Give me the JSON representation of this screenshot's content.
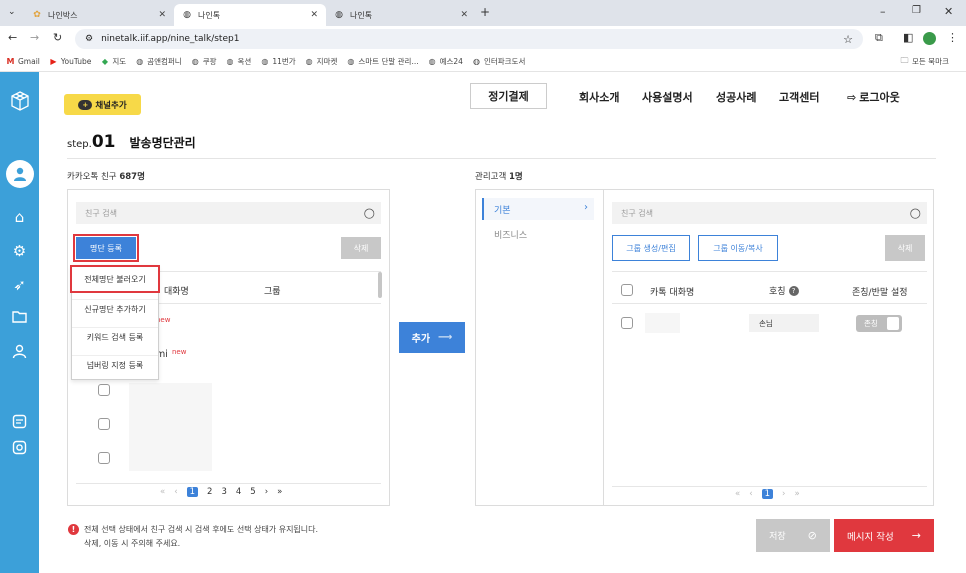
{
  "browser": {
    "tabs": [
      {
        "title": "나인박스",
        "active": false
      },
      {
        "title": "나인톡",
        "active": true
      },
      {
        "title": "나인톡",
        "active": false
      }
    ],
    "new_tab": "+",
    "url": "ninetalk.iif.app/nine_talk/step1",
    "bookmarks": [
      "Gmail",
      "YouTube",
      "지도",
      "곰앤컴퍼니",
      "쿠팡",
      "옥션",
      "11번가",
      "지마켓",
      "스마트 단말 관리...",
      "예스24",
      "인터파크도서"
    ],
    "all_bookmarks": "모든 북마크"
  },
  "header": {
    "channel_add": "채널추가",
    "regular_payment": "정기결제",
    "nav": [
      "회사소개",
      "사용설명서",
      "성공사례",
      "고객센터"
    ],
    "logout": "로그아웃"
  },
  "step": {
    "prefix": "step.",
    "number": "01",
    "title": "발송명단관리"
  },
  "left": {
    "friends_label": "카카오톡 친구",
    "friends_count": "687명",
    "search_placeholder": "친구 검색",
    "register_btn": "명단 등록",
    "delete_btn": "삭제",
    "dropdown": [
      "전체명단 불러오기",
      "신규명단 추가하기",
      "키워드 검색 등록",
      "넘버링 지정 등록"
    ],
    "col_chat": "대화명",
    "col_group": "그룹",
    "row_new": "new",
    "row2_partial": "mi",
    "pagination": {
      "first": "«",
      "prev": "‹",
      "pages": [
        "1",
        "2",
        "3",
        "4",
        "5"
      ],
      "next": "›",
      "last": "»"
    }
  },
  "add_button": "추가",
  "right": {
    "managed_label": "관리고객",
    "managed_count": "1명",
    "categories": [
      "기본",
      "비즈니스"
    ],
    "search_placeholder": "친구 검색",
    "group_create": "그룹 생성/편집",
    "group_move": "그룹 이동/복사",
    "delete_btn": "삭제",
    "col_chat": "카톡 대화명",
    "col_title": "호칭",
    "col_honor": "존칭/반말 설정",
    "row": {
      "title": "손님",
      "toggle": "존칭"
    },
    "pagination": {
      "first": "«",
      "prev": "‹",
      "page": "1",
      "next": "›",
      "last": "»"
    }
  },
  "notice": {
    "line1": "전체 선택 상태에서 친구 검색 시 검색 후에도 선택 상태가 유지됩니다.",
    "line2": "삭제, 이동 시 주의해 주세요."
  },
  "footer": {
    "save": "저장",
    "compose": "메시지 작성"
  },
  "colors": {
    "sidebar": "#3ca0d9",
    "accent": "#3d82d9",
    "red": "#e0383e",
    "yellow": "#f7d948"
  }
}
